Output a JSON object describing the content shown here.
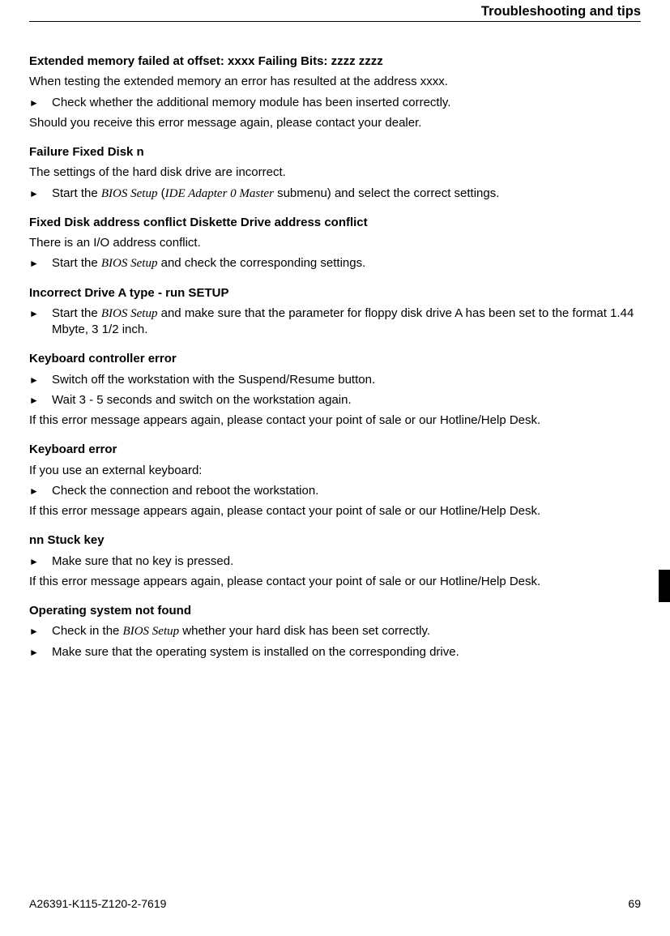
{
  "header": {
    "title": "Troubleshooting and tips"
  },
  "footer": {
    "doc_number": "A26391-K115-Z120-2-7619",
    "page": "69"
  },
  "sections": [
    {
      "title": "Extended memory failed at offset: xxxx  Failing Bits: zzzz zzzz",
      "intro": "When testing the extended memory an error has resulted at the address xxxx.",
      "bullets": [
        {
          "segments": [
            {
              "text": "Check whether the additional memory module has been inserted correctly."
            }
          ]
        }
      ],
      "outro": "Should you receive this error message again, please contact your dealer."
    },
    {
      "title": "Failure Fixed Disk n",
      "intro": "The settings of the hard disk drive are incorrect.",
      "bullets": [
        {
          "segments": [
            {
              "text": "Start the "
            },
            {
              "text": "BIOS Setup",
              "ital": true
            },
            {
              "text": " ("
            },
            {
              "text": "IDE Adapter 0 Master",
              "ital": true
            },
            {
              "text": " submenu) and select the correct settings."
            }
          ]
        }
      ]
    },
    {
      "title": "Fixed Disk address conflict Diskette Drive address conflict",
      "intro": "There is an I/O address conflict.",
      "bullets": [
        {
          "segments": [
            {
              "text": "Start the "
            },
            {
              "text": "BIOS Setup",
              "ital": true
            },
            {
              "text": " and check the corresponding settings."
            }
          ]
        }
      ]
    },
    {
      "title": "Incorrect Drive A type - run SETUP",
      "bullets": [
        {
          "segments": [
            {
              "text": "Start the "
            },
            {
              "text": "BIOS Setup",
              "ital": true
            },
            {
              "text": " and make sure that the parameter for floppy disk drive A has been set to the format 1.44 Mbyte, 3 1/2 inch."
            }
          ]
        }
      ]
    },
    {
      "title": "Keyboard controller error",
      "bullets": [
        {
          "segments": [
            {
              "text": "Switch off the workstation with the Suspend/Resume button."
            }
          ]
        },
        {
          "segments": [
            {
              "text": "Wait 3 - 5 seconds and switch on the workstation again."
            }
          ]
        }
      ],
      "outro": "If this error message appears again, please contact your point of sale or our Hotline/Help Desk."
    },
    {
      "title": "Keyboard error",
      "intro": "If you use an external keyboard:",
      "bullets": [
        {
          "segments": [
            {
              "text": "Check the connection and reboot the workstation."
            }
          ]
        }
      ],
      "outro": "If this error message appears again, please contact your point of sale or our Hotline/Help Desk."
    },
    {
      "title": "nn Stuck key",
      "bullets": [
        {
          "segments": [
            {
              "text": "Make sure that no key is pressed."
            }
          ]
        }
      ],
      "outro": "If this error message appears again, please contact your point of sale or our Hotline/Help Desk."
    },
    {
      "title": "Operating system not found",
      "bullets": [
        {
          "segments": [
            {
              "text": "Check in the "
            },
            {
              "text": "BIOS Setup",
              "ital": true
            },
            {
              "text": " whether your hard disk has been set correctly."
            }
          ]
        },
        {
          "segments": [
            {
              "text": "Make sure that the operating system is installed on the corresponding drive."
            }
          ]
        }
      ]
    }
  ]
}
